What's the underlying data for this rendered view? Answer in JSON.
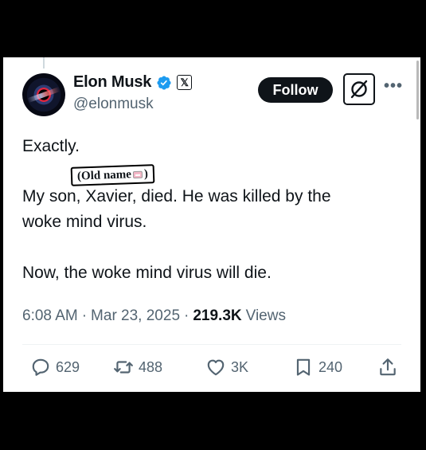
{
  "author": {
    "name": "Elon Musk",
    "handle": "@elonmusk",
    "affiliation_badge": "𝕏"
  },
  "header": {
    "follow_label": "Follow"
  },
  "sticker": {
    "label": "(Old name",
    "suffix": ")"
  },
  "post": {
    "line1": "Exactly.",
    "line2": "My son, Xavier, died. He was killed by the",
    "line3": "woke mind virus.",
    "line4": "Now, the woke mind virus will die."
  },
  "meta": {
    "time": "6:08 AM",
    "date": "Mar 23, 2025",
    "views_count": "219.3K",
    "views_label": "Views",
    "separator": "·"
  },
  "actions": {
    "replies": "629",
    "reposts": "488",
    "likes": "3K",
    "bookmarks": "240"
  },
  "colors": {
    "verified": "#1d9bf0",
    "text": "#0f1419",
    "secondary": "#536471"
  }
}
